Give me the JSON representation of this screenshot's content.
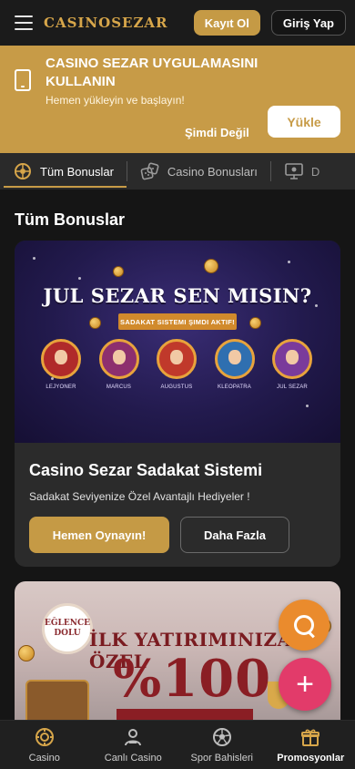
{
  "header": {
    "logo": "CASINOSEZAR",
    "register_label": "Kayıt Ol",
    "login_label": "Giriş Yap"
  },
  "install_banner": {
    "title": "CASINO SEZAR UYGULAMASINI KULLANIN",
    "subtitle": "Hemen yükleyin ve başlayın!",
    "later_label": "Şimdi Değil",
    "install_label": "Yükle"
  },
  "tabs": [
    {
      "label": "Tüm Bonuslar",
      "icon": "bonus-wheel-icon",
      "active": true
    },
    {
      "label": "Casino Bonusları",
      "icon": "dice-icon",
      "active": false
    },
    {
      "label": "D",
      "icon": "monitor-icon",
      "active": false
    }
  ],
  "section_title": "Tüm Bonuslar",
  "bonus_card": {
    "hero_title": "JUL SEZAR SEN MISIN?",
    "hero_ribbon": "SADAKAT SISTEMI ŞIMDI AKTIF!",
    "characters": [
      "LEJYONER",
      "MARCUS",
      "AUGUSTUS",
      "KLEOPATRA",
      "JUL SEZAR"
    ],
    "title": "Casino Sezar Sadakat Sistemi",
    "description": "Sadakat Seviyenize Özel Avantajlı Hediyeler !",
    "play_label": "Hemen Oynayın!",
    "more_label": "Daha Fazla"
  },
  "promo_card": {
    "badge_line1": "EĞLENCE",
    "badge_line2": "DOLU",
    "title": "İLK YATIRIMINIZA ÖZEL",
    "big_text": "%100"
  },
  "bottom_nav": [
    {
      "label": "Casino",
      "icon": "casino-chip-icon",
      "active": false
    },
    {
      "label": "Canlı Casino",
      "icon": "live-dealer-icon",
      "active": false
    },
    {
      "label": "Spor Bahisleri",
      "icon": "soccer-ball-icon",
      "active": false
    },
    {
      "label": "Promosyonlar",
      "icon": "gift-icon",
      "active": true
    }
  ],
  "colors": {
    "accent": "#c59a45",
    "banner": "#c79b47",
    "chat_fab": "#ea8b2d",
    "add_fab": "#e23b6a"
  }
}
